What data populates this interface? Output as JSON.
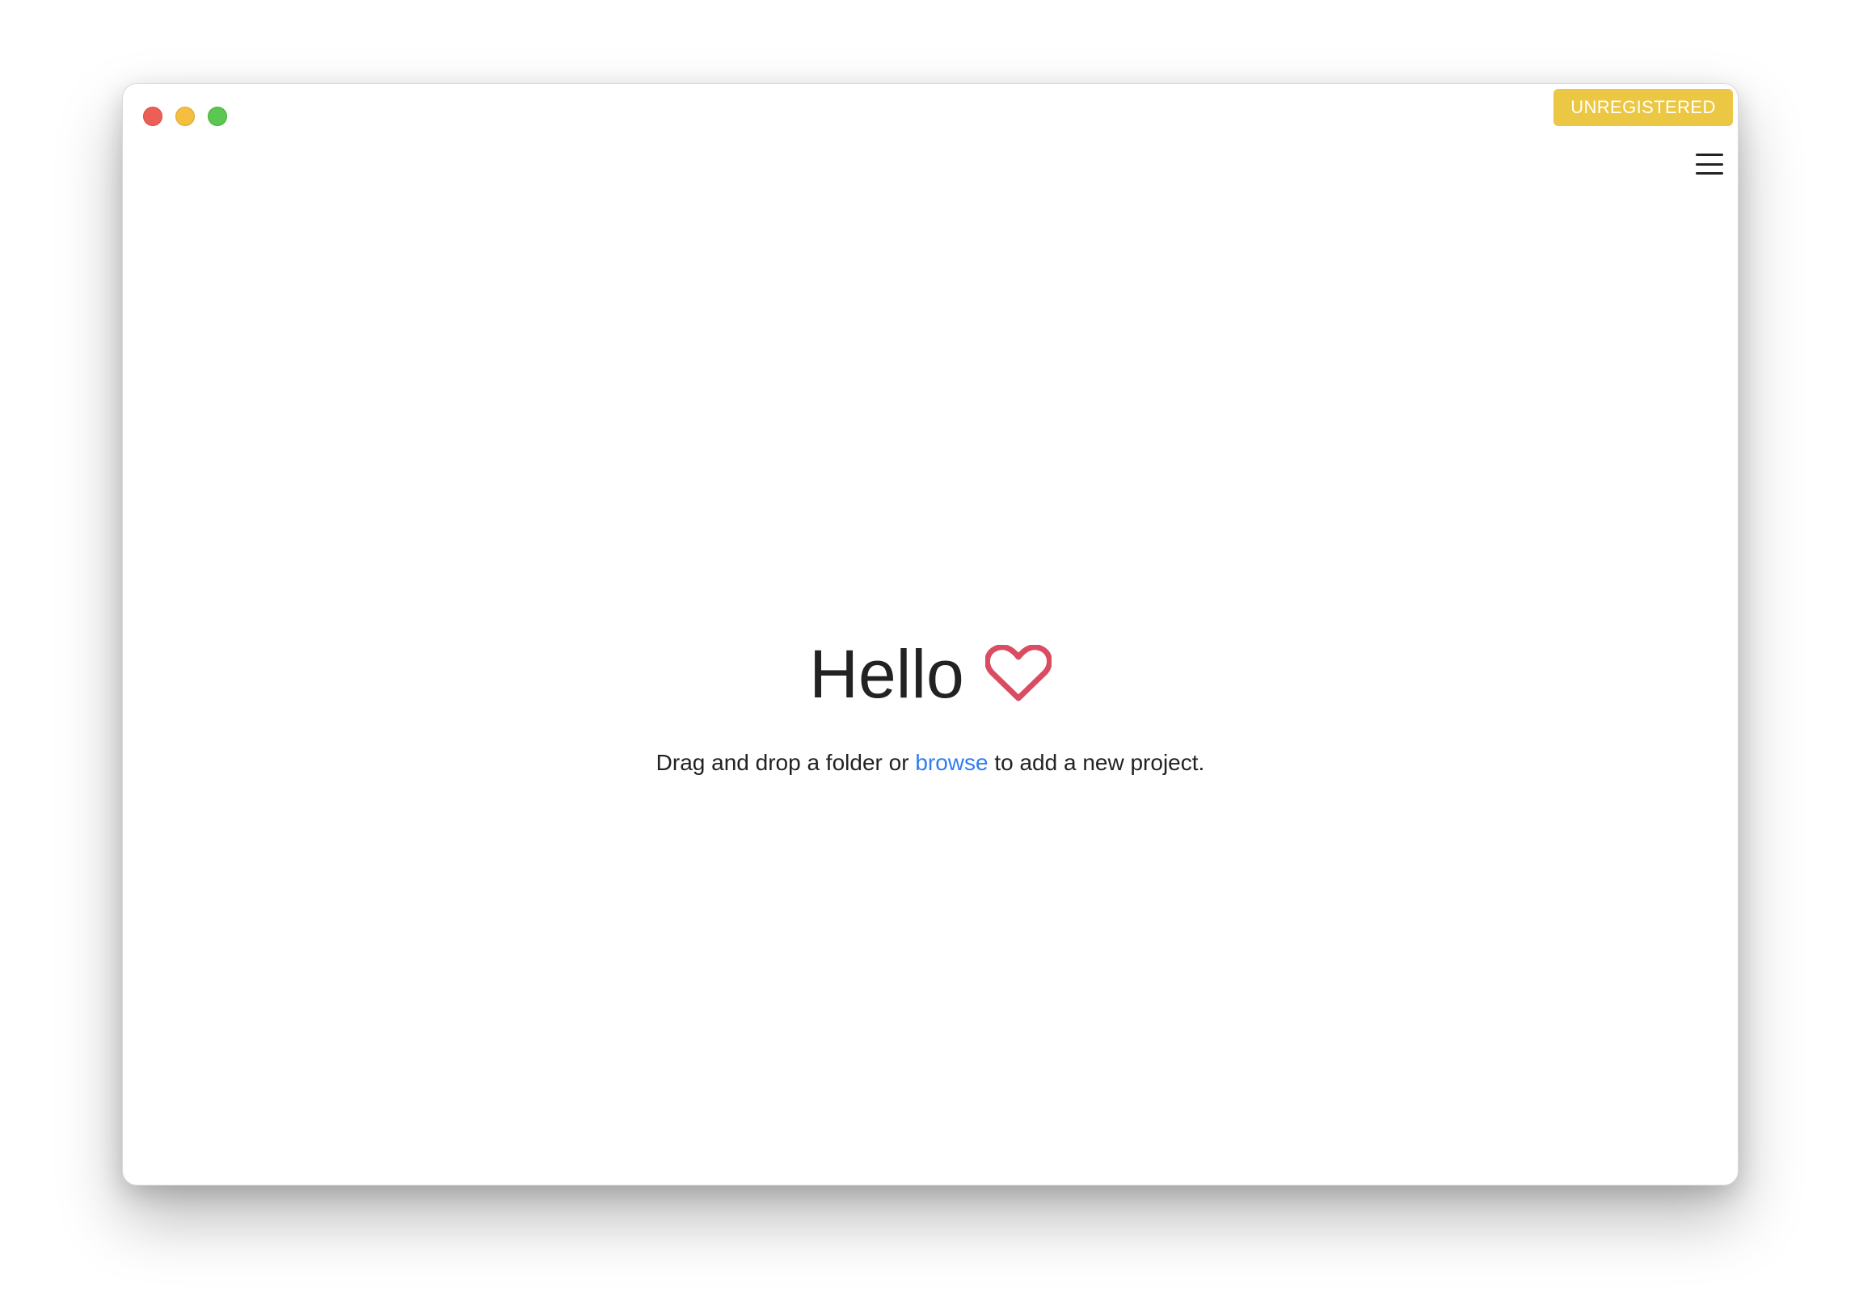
{
  "window": {
    "controls": {
      "close": "close",
      "minimize": "minimize",
      "zoom": "zoom"
    },
    "badge_label": "UNREGISTERED",
    "menu_icon": "hamburger-menu-icon"
  },
  "main": {
    "greeting": "Hello",
    "heart_icon": "heart-icon",
    "instruction_prefix": "Drag and drop a folder or ",
    "instruction_link": "browse",
    "instruction_suffix": " to add a new project."
  },
  "colors": {
    "badge": "#ebc743",
    "heart": "#d94c61",
    "link": "#2f7cf6"
  }
}
